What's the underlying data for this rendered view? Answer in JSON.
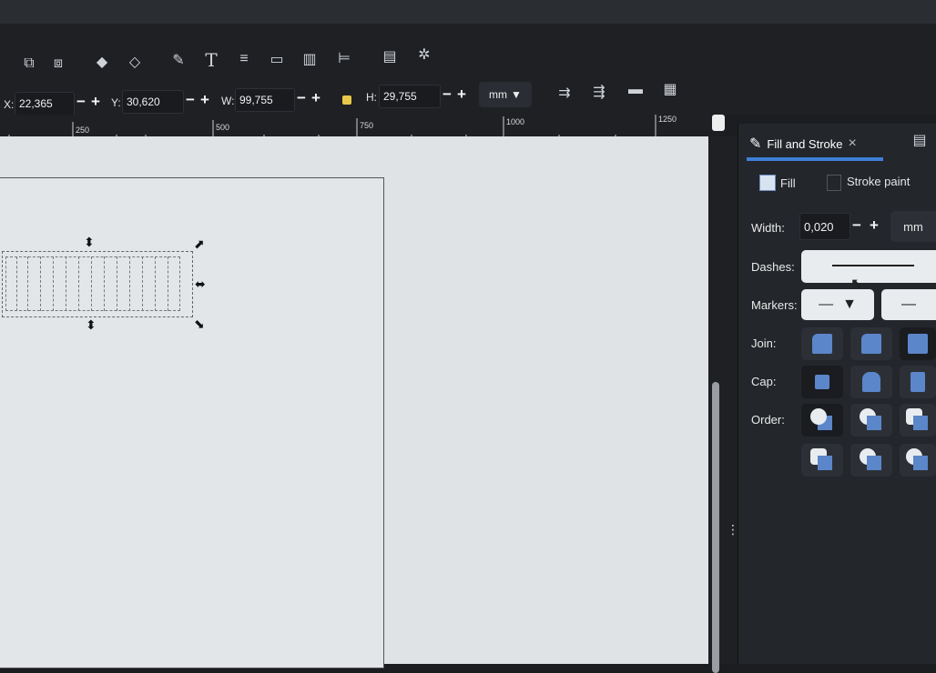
{
  "toolbar": {
    "icons": [
      "duplicate-icon",
      "clone-icon",
      "group-icon",
      "ungroup-icon",
      "pencil-icon",
      "text-icon",
      "layers-icon",
      "xml-icon",
      "objects-icon",
      "align-icon",
      "document-icon",
      "symbols-icon"
    ]
  },
  "controls": {
    "x_label": "X:",
    "x_value": "22,365",
    "y_label": "Y:",
    "y_value": "30,620",
    "w_label": "W:",
    "w_value": "99,755",
    "h_label": "H:",
    "h_value": "29,755",
    "minus": "−",
    "plus": "+",
    "unit": "mm"
  },
  "ruler": {
    "ticks": [
      "250",
      "500",
      "750",
      "1000",
      "1250"
    ]
  },
  "panel": {
    "tab_label": "Fill and Stroke",
    "tab_close": "×",
    "fill_tab": "Fill",
    "stroke_paint_tab": "Stroke paint",
    "width_label": "Width:",
    "width_value": "0,020",
    "width_unit": "mm",
    "dashes_label": "Dashes:",
    "markers_label": "Markers:",
    "join_label": "Join:",
    "cap_label": "Cap:",
    "order_label": "Order:"
  },
  "colors": {
    "accent": "#3f7fd8",
    "icon_blue": "#5b86c9",
    "canvas": "#dfe3e5",
    "panel": "#23262b"
  }
}
